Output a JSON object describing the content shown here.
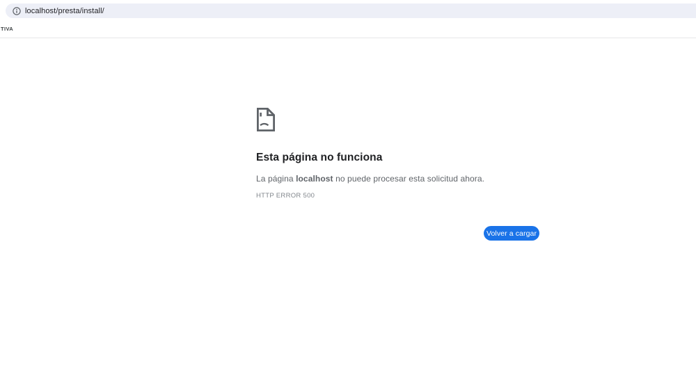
{
  "browser": {
    "url": "localhost/presta/install/",
    "bookmarks": [
      {
        "label": "TIVA"
      }
    ]
  },
  "error_page": {
    "title": "Esta página no funciona",
    "message_prefix": "La página ",
    "message_host": "localhost",
    "message_suffix": " no puede procesar esta solicitud ahora.",
    "error_code": "HTTP ERROR 500",
    "reload_button_label": "Volver a cargar"
  },
  "icons": {
    "omnibox": "info-icon",
    "error": "sad-page-icon"
  },
  "colors": {
    "accent_blue": "#1a73e8",
    "omnibox_bg": "#edeff7",
    "url_text": "#1d1d21",
    "title_text": "#202124",
    "body_text": "#5f6368",
    "code_text": "#81868c",
    "icon_gray": "#5f6368",
    "divider": "#e6e6e8"
  }
}
